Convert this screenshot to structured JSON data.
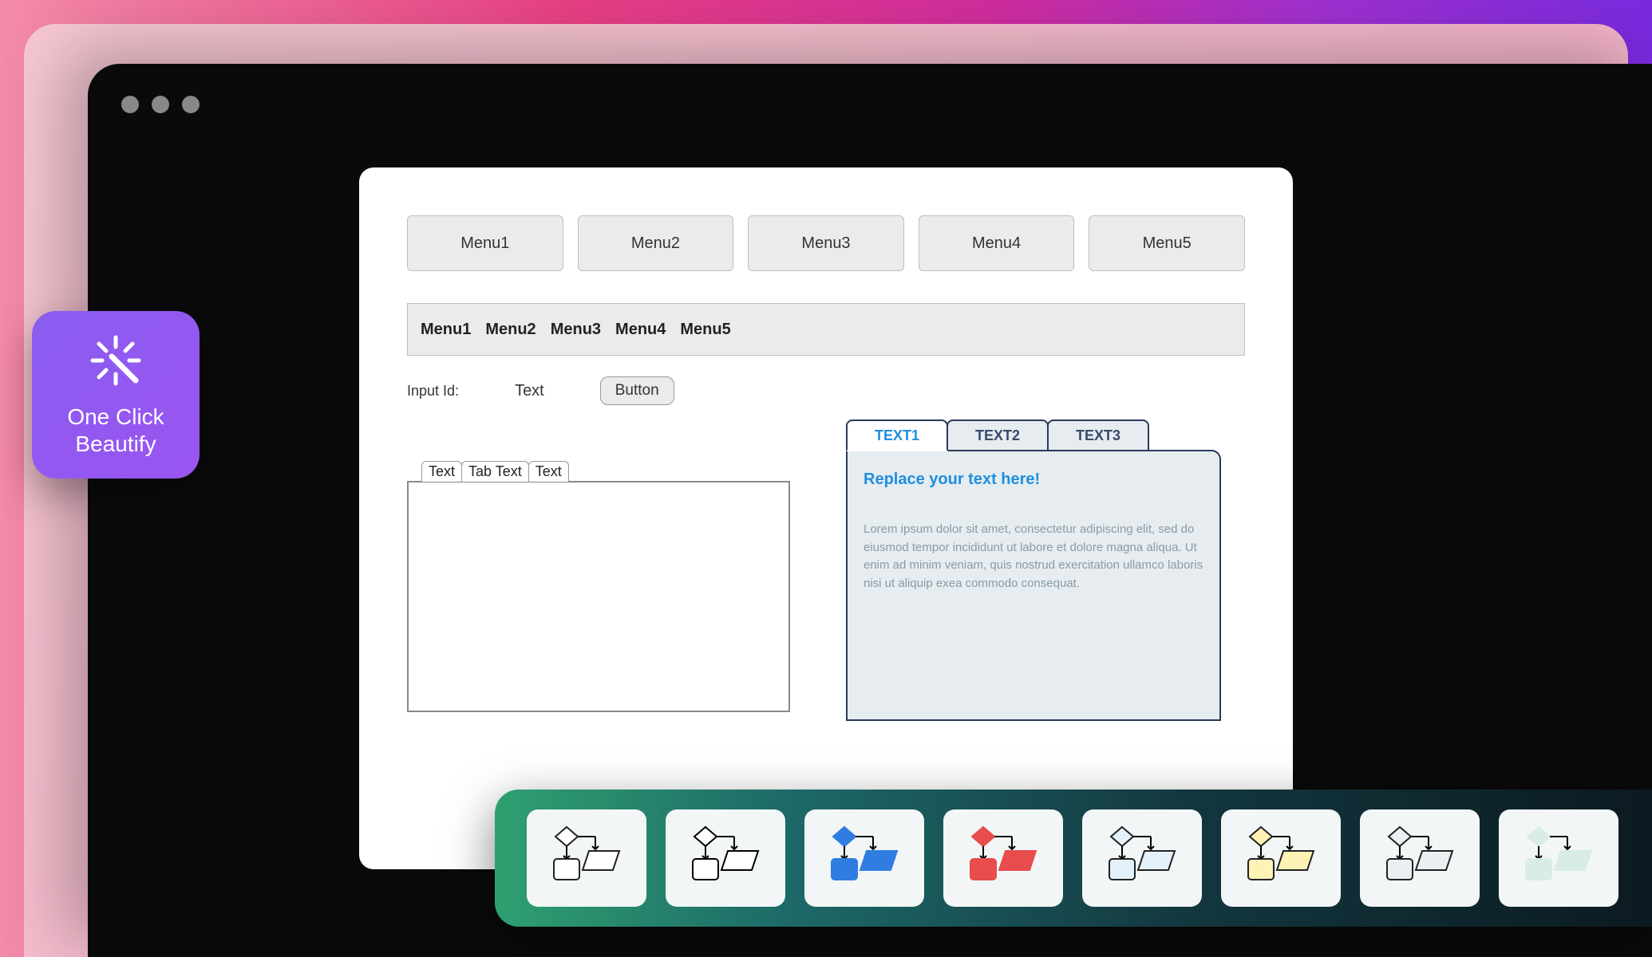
{
  "badge": {
    "line1": "One Click",
    "line2": "Beautify"
  },
  "menu_buttons": [
    "Menu1",
    "Menu2",
    "Menu3",
    "Menu4",
    "Menu5"
  ],
  "menu_bar": [
    "Menu1",
    "Menu2",
    "Menu3",
    "Menu4",
    "Menu5"
  ],
  "form": {
    "label": "Input Id:",
    "value": "Text",
    "button": "Button"
  },
  "left_tabs": [
    "Text",
    "Tab Text",
    "Text"
  ],
  "right_tabs": [
    "TEXT1",
    "TEXT2",
    "TEXT3"
  ],
  "right_panel": {
    "title": "Replace your text here!",
    "body": "Lorem ipsum dolor sit amet, consectetur adipiscing elit, sed do eiusmod tempor incididunt ut labore et dolore magna aliqua. Ut enim ad minim veniam, quis nostrud exercitation ullamco laboris nisi ut aliquip exea commodo consequat."
  },
  "themes": [
    {
      "name": "default-white",
      "diamond": "#fff",
      "diamondStroke": "#222",
      "rect": "#fff",
      "rectStroke": "#222",
      "para": "#fff",
      "paraStroke": "#222"
    },
    {
      "name": "outline-black",
      "diamond": "#fff",
      "diamondStroke": "#000",
      "rect": "#fff",
      "rectStroke": "#000",
      "para": "#fff",
      "paraStroke": "#000"
    },
    {
      "name": "blue",
      "diamond": "#2f7de0",
      "diamondStroke": "#2f7de0",
      "rect": "#2f7de0",
      "rectStroke": "#2f7de0",
      "para": "#2f7de0",
      "paraStroke": "#2f7de0"
    },
    {
      "name": "red",
      "diamond": "#e84c4c",
      "diamondStroke": "#e84c4c",
      "rect": "#e84c4c",
      "rectStroke": "#e84c4c",
      "para": "#e84c4c",
      "paraStroke": "#e84c4c"
    },
    {
      "name": "light-blue",
      "diamond": "#e3f1fb",
      "diamondStroke": "#222",
      "rect": "#e3f1fb",
      "rectStroke": "#222",
      "para": "#e3f1fb",
      "paraStroke": "#222"
    },
    {
      "name": "light-yellow",
      "diamond": "#fdf3b6",
      "diamondStroke": "#222",
      "rect": "#fdf3b6",
      "rectStroke": "#222",
      "para": "#fdf3b6",
      "paraStroke": "#222"
    },
    {
      "name": "light-gray",
      "diamond": "#eceff1",
      "diamondStroke": "#222",
      "rect": "#eceff1",
      "rectStroke": "#222",
      "para": "#eceff1",
      "paraStroke": "#222"
    },
    {
      "name": "light-teal",
      "diamond": "#d8ede3",
      "diamondStroke": "#d8ede3",
      "rect": "#d8ede3",
      "rectStroke": "#d8ede3",
      "para": "#d8ede3",
      "paraStroke": "#d8ede3"
    }
  ]
}
